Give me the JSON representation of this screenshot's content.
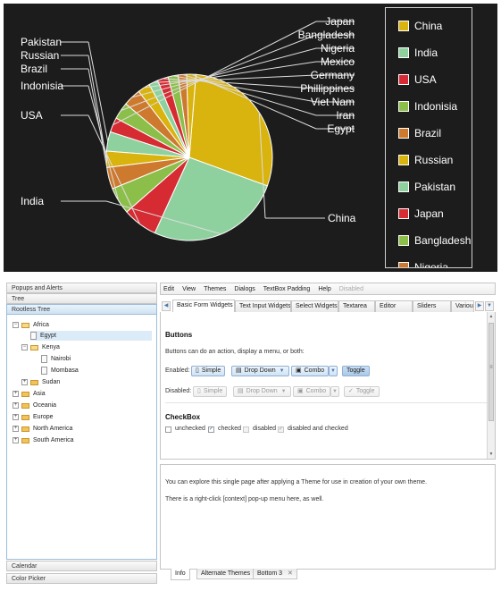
{
  "chart_data": {
    "type": "pie",
    "labels": [
      "China",
      "India",
      "USA",
      "Indonisia",
      "Brazil",
      "Russian",
      "Pakistan",
      "Japan",
      "Bangladesh",
      "Nigeria",
      "Mexico",
      "Germany",
      "Phillippines",
      "Viet Nam",
      "Iran",
      "Egypt"
    ],
    "values": [
      19.5,
      17.5,
      4.5,
      3.5,
      2.8,
      2.1,
      2.5,
      1.9,
      2.2,
      2.3,
      1.6,
      1.2,
      1.4,
      1.3,
      1.1,
      1.2
    ],
    "colors": [
      "#d9b30e",
      "#8fd19e",
      "#d62b32",
      "#8bbf4a",
      "#cd7a2f",
      "#d9b30e",
      "#8fd19e",
      "#d62b32",
      "#8bbf4a",
      "#cd7a2f",
      "#d9b30e",
      "#8fd19e",
      "#d62b32",
      "#8bbf4a",
      "#cd7a2f",
      "#d9b30e"
    ],
    "legend": [
      "China",
      "India",
      "USA",
      "Indonisia",
      "Brazil",
      "Russian",
      "Pakistan",
      "Japan",
      "Bangladesh",
      "Nigeria"
    ]
  },
  "accordion": {
    "popups": "Popups and Alerts",
    "tree": "Tree",
    "rootless": "Rootless Tree",
    "calendar": "Calendar",
    "color": "Color Picker"
  },
  "tree_nodes": {
    "africa": "Africa",
    "egypt": "Egypt",
    "kenya": "Kenya",
    "nairobi": "Nairobi",
    "mombasa": "Mombasa",
    "sudan": "Sudan",
    "asia": "Asia",
    "oceania": "Oceania",
    "europe": "Europe",
    "north_america": "North America",
    "south_america": "South America",
    "expand": "+",
    "collapse": "−"
  },
  "menubar": {
    "edit": "Edit",
    "view": "View",
    "themes": "Themes",
    "dialogs": "Dialogs",
    "textbox": "TextBox Padding",
    "help": "Help",
    "disabled": "Disabled"
  },
  "tabs": {
    "t1": "Basic Form Widgets",
    "t2": "Text Input Widgets",
    "t3": "Select Widgets",
    "t4": "Textarea",
    "t5": "Editor",
    "t6": "Sliders",
    "t7": "Various",
    "prev": "◀",
    "next": "▶",
    "menu": "▼"
  },
  "buttons_section": {
    "title": "Buttons",
    "desc": "Buttons can do an action, display a menu, or both:",
    "enabled_label": "Enabled:",
    "disabled_label": "Disabled:",
    "simple": "Simple",
    "dropdown": "Drop Down",
    "combo": "Combo",
    "toggle": "Toggle",
    "check_mark": "✓"
  },
  "checkbox_section": {
    "title": "CheckBox",
    "unchecked": "unchecked",
    "checked": "checked",
    "disabled": "disabled",
    "disabled_checked": "disabled and checked",
    "mark": "✓"
  },
  "bottom": {
    "line1": "You can explore this single page after applying a Theme for use in creation of your own theme.",
    "line2": "There is a right-click [context] pop-up menu here, as well.",
    "tab_info": "Info",
    "tab_alt": "Alternate Themes",
    "tab_b3": "Bottom 3",
    "close": "✕"
  },
  "scroll": {
    "up": "▲",
    "down": "▼",
    "grip": "≡"
  }
}
